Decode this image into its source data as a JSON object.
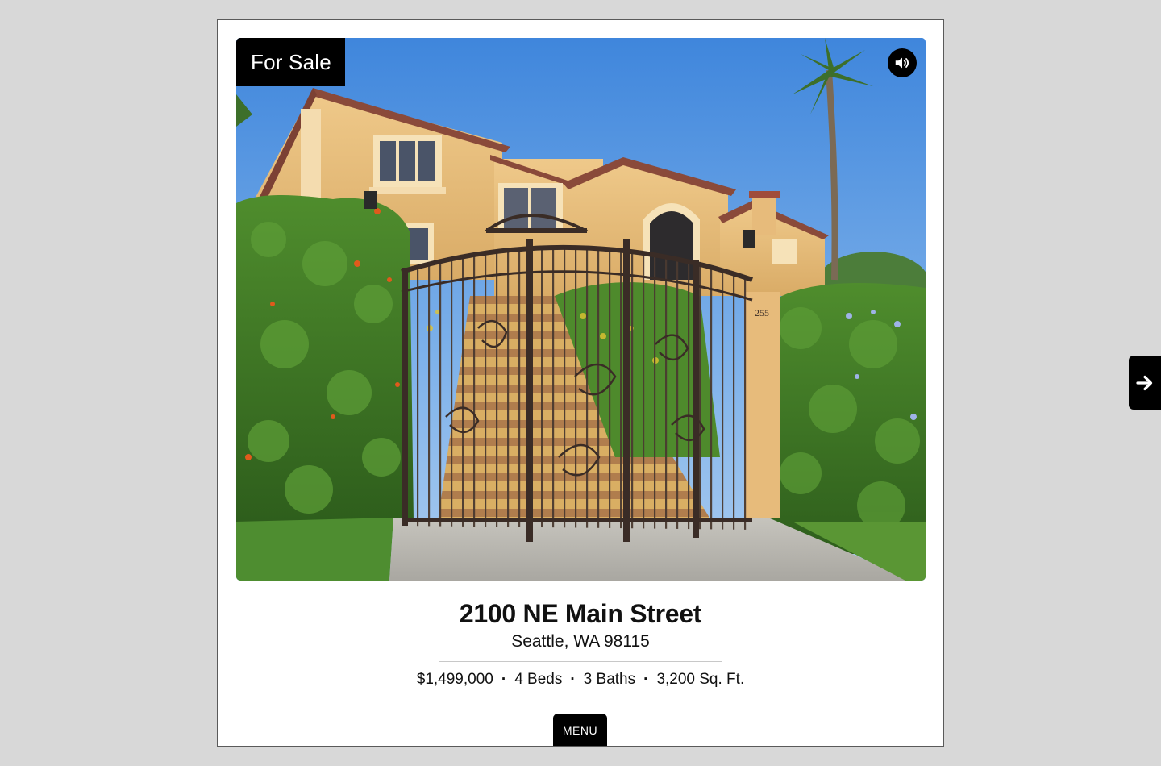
{
  "listing": {
    "status_badge": "For Sale",
    "address_line1": "2100 NE Main Street",
    "address_line2": "Seattle, WA 98115",
    "price": "$1,499,000",
    "beds": "4 Beds",
    "baths": "3 Baths",
    "area": "3,200 Sq. Ft.",
    "separator": "·"
  },
  "controls": {
    "menu_label": "MENU",
    "sound_icon": "speaker-volume-icon",
    "next_icon": "arrow-right-icon"
  },
  "photo": {
    "house_number": "255"
  },
  "colors": {
    "page_background": "#d8d8d8",
    "card_background": "#ffffff",
    "accent_black": "#000000"
  }
}
